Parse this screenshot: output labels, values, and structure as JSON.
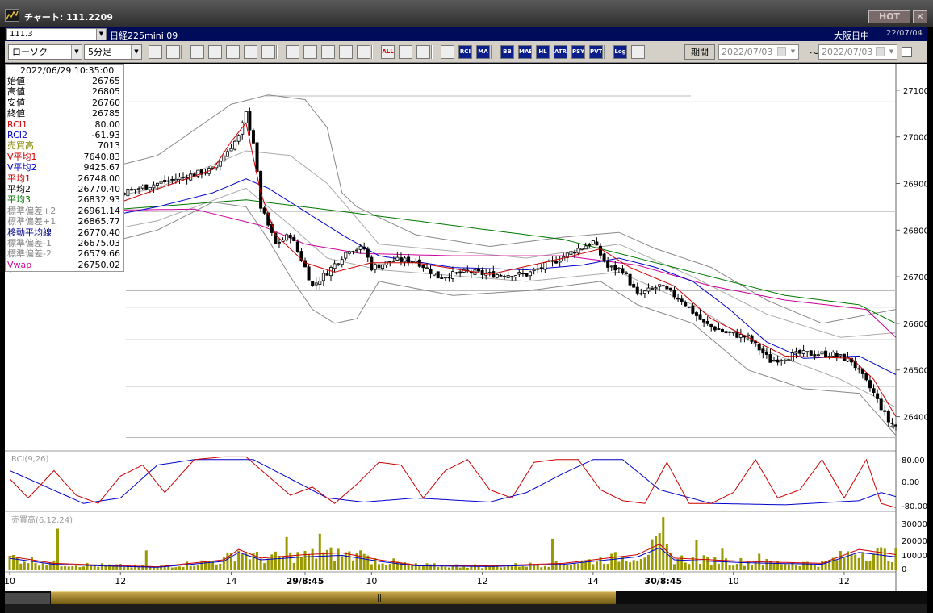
{
  "window": {
    "title": "チャート: 111.2209",
    "hot_label": "HOT",
    "close_label": "✕"
  },
  "info": {
    "code": "111.3",
    "symbol": "日経225mini 09",
    "market": "大阪日中",
    "date": "22/07/04"
  },
  "toolbar": {
    "chart_type": "ローソク",
    "interval": "5分足",
    "buttons": [
      "zoom",
      "crosshair",
      "draw-down",
      "search",
      "bar-scale",
      "compare",
      "blank",
      "pen",
      "pointer",
      "rewind",
      "candle-a",
      "candle-b",
      "all",
      "config",
      "wrench",
      "palette",
      "rci",
      "ma",
      "bb",
      "mae",
      "hl",
      "atr",
      "psy",
      "pvt",
      "log",
      "export"
    ],
    "button_labels": {
      "all": "ALL",
      "rci": "RCI",
      "ma": "MA",
      "bb": "BB",
      "mae": "MAE",
      "hl": "HL",
      "atr": "ATR",
      "psy": "PSY",
      "pvt": "PVT",
      "log": "Log"
    },
    "period_label": "期間",
    "from_date": "2022/07/03",
    "tilde": "〜",
    "to_date": "2022/07/03"
  },
  "data_panel": {
    "datetime": "2022/06/29  10:35:00",
    "rows": [
      {
        "label": "始値",
        "value": "26765",
        "color": "#000000"
      },
      {
        "label": "高値",
        "value": "26805",
        "color": "#000000"
      },
      {
        "label": "安値",
        "value": "26760",
        "color": "#000000"
      },
      {
        "label": "終値",
        "value": "26785",
        "color": "#000000"
      },
      {
        "label": "RCI1",
        "value": "80.00",
        "color": "#cc0000"
      },
      {
        "label": "RCI2",
        "value": "-61.93",
        "color": "#0000cc"
      },
      {
        "label": "売買高",
        "value": "7013",
        "color": "#888800"
      },
      {
        "label": "V平均1",
        "value": "7640.83",
        "color": "#cc0000"
      },
      {
        "label": "V平均2",
        "value": "9425.67",
        "color": "#0000cc"
      },
      {
        "label": "平均1",
        "value": "26748.00",
        "color": "#cc0000"
      },
      {
        "label": "平均2",
        "value": "26770.40",
        "color": "#000000"
      },
      {
        "label": "平均3",
        "value": "26832.93",
        "color": "#007700"
      },
      {
        "label": "標準偏差+2",
        "value": "26961.14",
        "color": "#888888"
      },
      {
        "label": "標準偏差+1",
        "value": "26865.77",
        "color": "#888888"
      },
      {
        "label": "移動平均線",
        "value": "26770.40",
        "color": "#000088"
      },
      {
        "label": "標準偏差-1",
        "value": "26675.03",
        "color": "#888888"
      },
      {
        "label": "標準偏差-2",
        "value": "26579.66",
        "color": "#888888"
      },
      {
        "label": "Vwap",
        "value": "26750.02",
        "color": "#cc0099"
      }
    ]
  },
  "chart_data": {
    "type": "candlestick",
    "price_axis": {
      "ticks": [
        27100,
        27000,
        26900,
        26800,
        26700,
        26600,
        26500,
        26400
      ],
      "range": [
        26330,
        27150
      ]
    },
    "rci_panel": {
      "label": "RCI(9,26)",
      "ticks": [
        "80.00",
        "0.00",
        "-80.00"
      ],
      "range": [
        -100,
        100
      ]
    },
    "volume_panel": {
      "label": "売買高(6,12,24)",
      "ticks": [
        "30000",
        "20000",
        "10000",
        "0"
      ],
      "range": [
        0,
        34000
      ]
    },
    "x_labels": [
      {
        "t": "10",
        "bold": false
      },
      {
        "t": "12",
        "bold": false
      },
      {
        "t": "14",
        "bold": false
      },
      {
        "t": "29/8:45",
        "bold": true
      },
      {
        "t": "10",
        "bold": false
      },
      {
        "t": "12",
        "bold": false
      },
      {
        "t": "14",
        "bold": false
      },
      {
        "t": "30/8:45",
        "bold": true
      },
      {
        "t": "10",
        "bold": false
      },
      {
        "t": "12",
        "bold": false
      }
    ],
    "price_keypoints": [
      [
        0,
        26780
      ],
      [
        8,
        26820
      ],
      [
        20,
        26850
      ],
      [
        30,
        26880
      ],
      [
        45,
        26910
      ],
      [
        55,
        26930
      ],
      [
        62,
        27000
      ],
      [
        64,
        27050
      ],
      [
        66,
        26990
      ],
      [
        68,
        26850
      ],
      [
        72,
        26770
      ],
      [
        76,
        26790
      ],
      [
        80,
        26720
      ],
      [
        82,
        26680
      ],
      [
        86,
        26710
      ],
      [
        92,
        26760
      ],
      [
        96,
        26760
      ],
      [
        98,
        26720
      ],
      [
        104,
        26735
      ],
      [
        110,
        26735
      ],
      [
        116,
        26700
      ],
      [
        124,
        26710
      ],
      [
        130,
        26705
      ],
      [
        140,
        26705
      ],
      [
        148,
        26735
      ],
      [
        154,
        26760
      ],
      [
        158,
        26775
      ],
      [
        162,
        26720
      ],
      [
        166,
        26715
      ],
      [
        170,
        26660
      ],
      [
        176,
        26680
      ],
      [
        182,
        26650
      ],
      [
        188,
        26600
      ],
      [
        194,
        26580
      ],
      [
        200,
        26570
      ],
      [
        206,
        26520
      ],
      [
        214,
        26535
      ],
      [
        222,
        26535
      ],
      [
        228,
        26520
      ],
      [
        234,
        26450
      ],
      [
        238,
        26390
      ],
      [
        240,
        26380
      ]
    ],
    "ma_avg1_keypoints": [
      [
        0,
        26790
      ],
      [
        30,
        26860
      ],
      [
        55,
        26930
      ],
      [
        60,
        26990
      ],
      [
        64,
        27030
      ],
      [
        68,
        26880
      ],
      [
        72,
        26790
      ],
      [
        80,
        26730
      ],
      [
        88,
        26710
      ],
      [
        98,
        26730
      ],
      [
        110,
        26730
      ],
      [
        130,
        26705
      ],
      [
        150,
        26740
      ],
      [
        160,
        26760
      ],
      [
        168,
        26720
      ],
      [
        180,
        26680
      ],
      [
        190,
        26610
      ],
      [
        200,
        26570
      ],
      [
        210,
        26530
      ],
      [
        228,
        26525
      ],
      [
        234,
        26480
      ],
      [
        240,
        26400
      ]
    ],
    "ma_avg2_keypoints": [
      [
        0,
        26800
      ],
      [
        20,
        26820
      ],
      [
        40,
        26850
      ],
      [
        55,
        26880
      ],
      [
        64,
        26910
      ],
      [
        70,
        26890
      ],
      [
        80,
        26840
      ],
      [
        90,
        26790
      ],
      [
        100,
        26745
      ],
      [
        120,
        26720
      ],
      [
        140,
        26715
      ],
      [
        155,
        26725
      ],
      [
        165,
        26740
      ],
      [
        175,
        26720
      ],
      [
        185,
        26690
      ],
      [
        195,
        26630
      ],
      [
        205,
        26560
      ],
      [
        215,
        26525
      ],
      [
        230,
        26530
      ],
      [
        240,
        26490
      ]
    ],
    "ma_avg3_keypoints": [
      [
        0,
        26840
      ],
      [
        30,
        26845
      ],
      [
        64,
        26865
      ],
      [
        90,
        26840
      ],
      [
        120,
        26810
      ],
      [
        150,
        26780
      ],
      [
        170,
        26740
      ],
      [
        190,
        26700
      ],
      [
        210,
        26660
      ],
      [
        230,
        26640
      ],
      [
        240,
        26600
      ]
    ],
    "vwap_keypoints": [
      [
        0,
        26840
      ],
      [
        50,
        26845
      ],
      [
        68,
        26810
      ],
      [
        80,
        26770
      ],
      [
        95,
        26750
      ],
      [
        120,
        26745
      ],
      [
        150,
        26745
      ],
      [
        170,
        26725
      ],
      [
        190,
        26680
      ],
      [
        210,
        26650
      ],
      [
        232,
        26630
      ],
      [
        240,
        26570
      ]
    ],
    "bb_upper_keypoints": [
      [
        0,
        26880
      ],
      [
        20,
        26920
      ],
      [
        40,
        26960
      ],
      [
        60,
        27070
      ],
      [
        70,
        27090
      ],
      [
        80,
        27080
      ],
      [
        86,
        27020
      ],
      [
        90,
        26880
      ],
      [
        94,
        26850
      ],
      [
        110,
        26790
      ],
      [
        130,
        26765
      ],
      [
        150,
        26785
      ],
      [
        165,
        26795
      ],
      [
        175,
        26760
      ],
      [
        190,
        26720
      ],
      [
        205,
        26650
      ],
      [
        220,
        26600
      ],
      [
        240,
        26630
      ]
    ],
    "bb_lower_keypoints": [
      [
        0,
        26710
      ],
      [
        20,
        26760
      ],
      [
        40,
        26800
      ],
      [
        55,
        26860
      ],
      [
        64,
        26850
      ],
      [
        70,
        26780
      ],
      [
        76,
        26700
      ],
      [
        82,
        26630
      ],
      [
        88,
        26600
      ],
      [
        94,
        26610
      ],
      [
        100,
        26690
      ],
      [
        120,
        26660
      ],
      [
        140,
        26670
      ],
      [
        160,
        26690
      ],
      [
        170,
        26640
      ],
      [
        185,
        26600
      ],
      [
        200,
        26500
      ],
      [
        215,
        26460
      ],
      [
        230,
        26450
      ],
      [
        240,
        26360
      ]
    ],
    "bb_upper1_keypoints": [
      [
        0,
        26830
      ],
      [
        40,
        26890
      ],
      [
        64,
        26970
      ],
      [
        76,
        26960
      ],
      [
        86,
        26900
      ],
      [
        100,
        26770
      ],
      [
        140,
        26740
      ],
      [
        165,
        26770
      ],
      [
        185,
        26700
      ],
      [
        205,
        26620
      ],
      [
        225,
        26570
      ],
      [
        240,
        26580
      ]
    ],
    "bb_lower1_keypoints": [
      [
        0,
        26760
      ],
      [
        40,
        26820
      ],
      [
        64,
        26890
      ],
      [
        76,
        26810
      ],
      [
        86,
        26740
      ],
      [
        100,
        26715
      ],
      [
        140,
        26690
      ],
      [
        165,
        26710
      ],
      [
        185,
        26640
      ],
      [
        205,
        26540
      ],
      [
        225,
        26480
      ],
      [
        240,
        26420
      ]
    ],
    "horizontal_levels": [
      27075,
      26840,
      26670,
      26635,
      26565,
      26465,
      26355
    ],
    "rci1_keypoints": [
      [
        0,
        10
      ],
      [
        5,
        -60
      ],
      [
        12,
        40
      ],
      [
        18,
        -50
      ],
      [
        24,
        -80
      ],
      [
        30,
        20
      ],
      [
        36,
        60
      ],
      [
        42,
        -40
      ],
      [
        50,
        80
      ],
      [
        58,
        90
      ],
      [
        64,
        90
      ],
      [
        70,
        20
      ],
      [
        76,
        -50
      ],
      [
        82,
        -20
      ],
      [
        88,
        -80
      ],
      [
        94,
        -10
      ],
      [
        100,
        70
      ],
      [
        106,
        60
      ],
      [
        112,
        -60
      ],
      [
        118,
        40
      ],
      [
        124,
        80
      ],
      [
        130,
        -30
      ],
      [
        136,
        -60
      ],
      [
        142,
        70
      ],
      [
        148,
        80
      ],
      [
        154,
        80
      ],
      [
        160,
        -30
      ],
      [
        166,
        -70
      ],
      [
        172,
        -80
      ],
      [
        178,
        70
      ],
      [
        184,
        -80
      ],
      [
        190,
        -80
      ],
      [
        196,
        -40
      ],
      [
        202,
        80
      ],
      [
        208,
        -60
      ],
      [
        214,
        -30
      ],
      [
        220,
        80
      ],
      [
        226,
        -60
      ],
      [
        232,
        80
      ],
      [
        236,
        -80
      ],
      [
        240,
        -95
      ]
    ],
    "rci2_keypoints": [
      [
        0,
        40
      ],
      [
        10,
        -20
      ],
      [
        20,
        -80
      ],
      [
        30,
        -60
      ],
      [
        40,
        60
      ],
      [
        50,
        80
      ],
      [
        66,
        80
      ],
      [
        76,
        10
      ],
      [
        86,
        -60
      ],
      [
        96,
        -75
      ],
      [
        110,
        -60
      ],
      [
        130,
        -75
      ],
      [
        140,
        -40
      ],
      [
        150,
        30
      ],
      [
        158,
        80
      ],
      [
        166,
        80
      ],
      [
        176,
        -30
      ],
      [
        190,
        -80
      ],
      [
        210,
        -85
      ],
      [
        230,
        -70
      ],
      [
        236,
        -40
      ],
      [
        240,
        -55
      ]
    ],
    "volume_keypoints": [
      [
        0,
        8000
      ],
      [
        6,
        6000
      ],
      [
        12,
        4000
      ],
      [
        24,
        3000
      ],
      [
        40,
        2000
      ],
      [
        58,
        6000
      ],
      [
        62,
        12000
      ],
      [
        68,
        7000
      ],
      [
        80,
        9000
      ],
      [
        90,
        10000
      ],
      [
        100,
        6000
      ],
      [
        110,
        3000
      ],
      [
        130,
        2500
      ],
      [
        150,
        4000
      ],
      [
        170,
        9000
      ],
      [
        176,
        15000
      ],
      [
        180,
        7000
      ],
      [
        200,
        5000
      ],
      [
        220,
        4000
      ],
      [
        230,
        12000
      ],
      [
        240,
        9000
      ]
    ],
    "volume_spikes": [
      [
        13,
        25000
      ],
      [
        37,
        12000
      ],
      [
        75,
        20000
      ],
      [
        84,
        22000
      ],
      [
        95,
        12000
      ],
      [
        147,
        19000
      ],
      [
        177,
        32000
      ],
      [
        186,
        18000
      ],
      [
        193,
        13000
      ],
      [
        203,
        10000
      ]
    ]
  }
}
